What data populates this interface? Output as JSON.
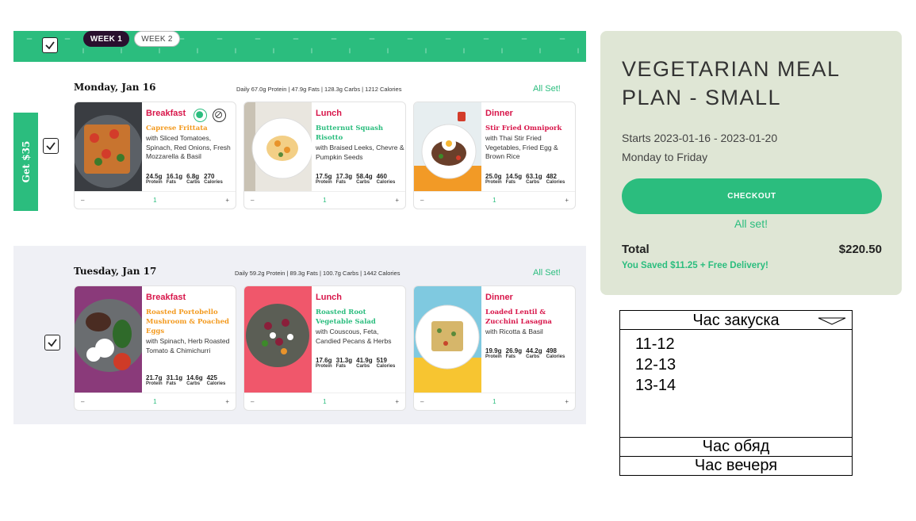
{
  "weeks": {
    "week1": "WEEK 1",
    "week2": "WEEK 2"
  },
  "promo": {
    "label": "Get $35"
  },
  "days": [
    {
      "title": "Monday, Jan 16",
      "summary": "Daily 67.0g Protein | 47.9g Fats | 128.3g Carbs | 1212 Calories",
      "status": "All Set!",
      "meals": [
        {
          "type": "Breakfast",
          "name": "Caprese Frittata",
          "name_color": "#f39a1f",
          "description": "with Sliced Tomatoes, Spinach, Red Onions, Fresh Mozzarella & Basil",
          "protein": "24.5g",
          "fats": "16.1g",
          "carbs": "6.8g",
          "calories": "270",
          "quantity": "1",
          "badges": [
            "vegetarian-icon",
            "gluten-free-icon"
          ]
        },
        {
          "type": "Lunch",
          "name": "Butternut Squash Risotto",
          "name_color": "#2bbd7e",
          "description": "with Braised Leeks, Chevre & Pumpkin Seeds",
          "protein": "17.5g",
          "fats": "17.3g",
          "carbs": "58.4g",
          "calories": "460",
          "quantity": "1"
        },
        {
          "type": "Dinner",
          "name": "Stir Fried Omnipork",
          "name_color": "#d8164a",
          "description": "with Thai Stir Fried Vegetables, Fried Egg & Brown Rice",
          "protein": "25.0g",
          "fats": "14.5g",
          "carbs": "63.1g",
          "calories": "482",
          "quantity": "1"
        }
      ]
    },
    {
      "title": "Tuesday, Jan 17",
      "summary": "Daily 59.2g Protein | 89.3g Fats | 100.7g Carbs | 1442 Calories",
      "status": "All Set!",
      "meals": [
        {
          "type": "Breakfast",
          "name": "Roasted Portobello Mushroom & Poached Eggs",
          "name_color": "#f39a1f",
          "description": "with Spinach, Herb Roasted Tomato & Chimichurri",
          "protein": "21.7g",
          "fats": "31.1g",
          "carbs": "14.6g",
          "calories": "425",
          "quantity": "1"
        },
        {
          "type": "Lunch",
          "name": "Roasted Root Vegetable Salad",
          "name_color": "#2bbd7e",
          "description": "with Couscous, Feta, Candied Pecans & Herbs",
          "protein": "17.6g",
          "fats": "31.3g",
          "carbs": "41.9g",
          "calories": "519",
          "quantity": "1"
        },
        {
          "type": "Dinner",
          "name": "Loaded Lentil & Zucchini Lasagna",
          "name_color": "#d8164a",
          "description": "with Ricotta & Basil",
          "protein": "19.9g",
          "fats": "26.9g",
          "carbs": "44.2g",
          "calories": "498",
          "quantity": "1"
        }
      ]
    }
  ],
  "macro_labels": {
    "protein": "Protein",
    "fats": "Fats",
    "carbs": "Carbs",
    "calories": "Calories"
  },
  "qty_controls": {
    "minus": "–",
    "plus": "+"
  },
  "order_summary": {
    "title_line1": "VEGETARIAN MEAL",
    "title_line2": "PLAN - SMALL",
    "dates": "Starts 2023-01-16 - 2023-01-20",
    "days": "Monday to Friday",
    "checkout": "CHECKOUT",
    "status": "All set!",
    "total_label": "Total",
    "total_value": "$220.50",
    "saved": "You Saved $11.25 + Free Delivery!"
  },
  "time_picker": {
    "header": "Час закуска",
    "options": [
      "11-12",
      "12-13",
      "13-14"
    ],
    "lunch": "Час обяд",
    "dinner": "Час вечеря"
  },
  "colors": {
    "accent": "#2bbd7e",
    "meal_type": "#d8164a",
    "dark_pill": "#2a0f2e",
    "summary_bg": "#dfe6d5",
    "day_bg": "#eff0f5"
  }
}
